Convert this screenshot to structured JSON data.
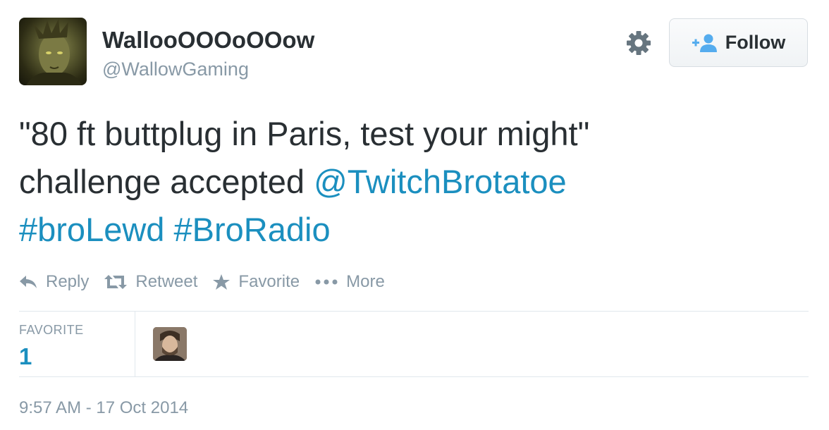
{
  "profile": {
    "display_name": "WallooOOOoOOow",
    "handle": "@WallowGaming"
  },
  "header": {
    "follow_label": "Follow"
  },
  "tweet": {
    "text_line1": "\"80 ft buttplug in Paris, test your might\"",
    "text_line2": "challenge accepted ",
    "mention": "@TwitchBrotatoe",
    "hashtag1": "#broLewd",
    "hashtag2": "#BroRadio"
  },
  "actions": {
    "reply": "Reply",
    "retweet": "Retweet",
    "favorite": "Favorite",
    "more": "More"
  },
  "stats": {
    "favorite_label": "FAVORITE",
    "favorite_count": "1"
  },
  "timestamp": "9:57 AM - 17 Oct 2014",
  "colors": {
    "link": "#1b8fbf",
    "muted": "#8899a6",
    "text": "#292f33"
  }
}
